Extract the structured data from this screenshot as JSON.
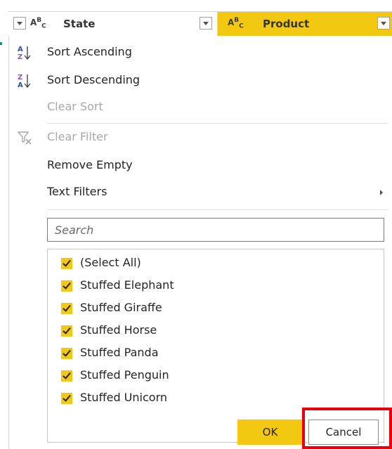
{
  "columns": [
    {
      "type_icon": "text-type-icon",
      "type_label": "ABC",
      "title": "State"
    },
    {
      "type_icon": "text-type-icon",
      "type_label": "ABC",
      "title": "Product"
    }
  ],
  "menu": {
    "sort_ascending": "Sort Ascending",
    "sort_descending": "Sort Descending",
    "clear_sort": "Clear Sort",
    "clear_filter": "Clear Filter",
    "remove_empty": "Remove Empty",
    "text_filters": "Text Filters"
  },
  "search": {
    "placeholder": "Search",
    "value": ""
  },
  "filter_list": [
    {
      "label": "(Select All)",
      "checked": true
    },
    {
      "label": "Stuffed Elephant",
      "checked": true
    },
    {
      "label": "Stuffed Giraffe",
      "checked": true
    },
    {
      "label": "Stuffed Horse",
      "checked": true
    },
    {
      "label": "Stuffed Panda",
      "checked": true
    },
    {
      "label": "Stuffed Penguin",
      "checked": true
    },
    {
      "label": "Stuffed Unicorn",
      "checked": true
    }
  ],
  "buttons": {
    "ok": "OK",
    "cancel": "Cancel"
  },
  "colors": {
    "accent": "#f2c811",
    "highlight": "#e8000b",
    "disabled_text": "#a8a8a8"
  }
}
